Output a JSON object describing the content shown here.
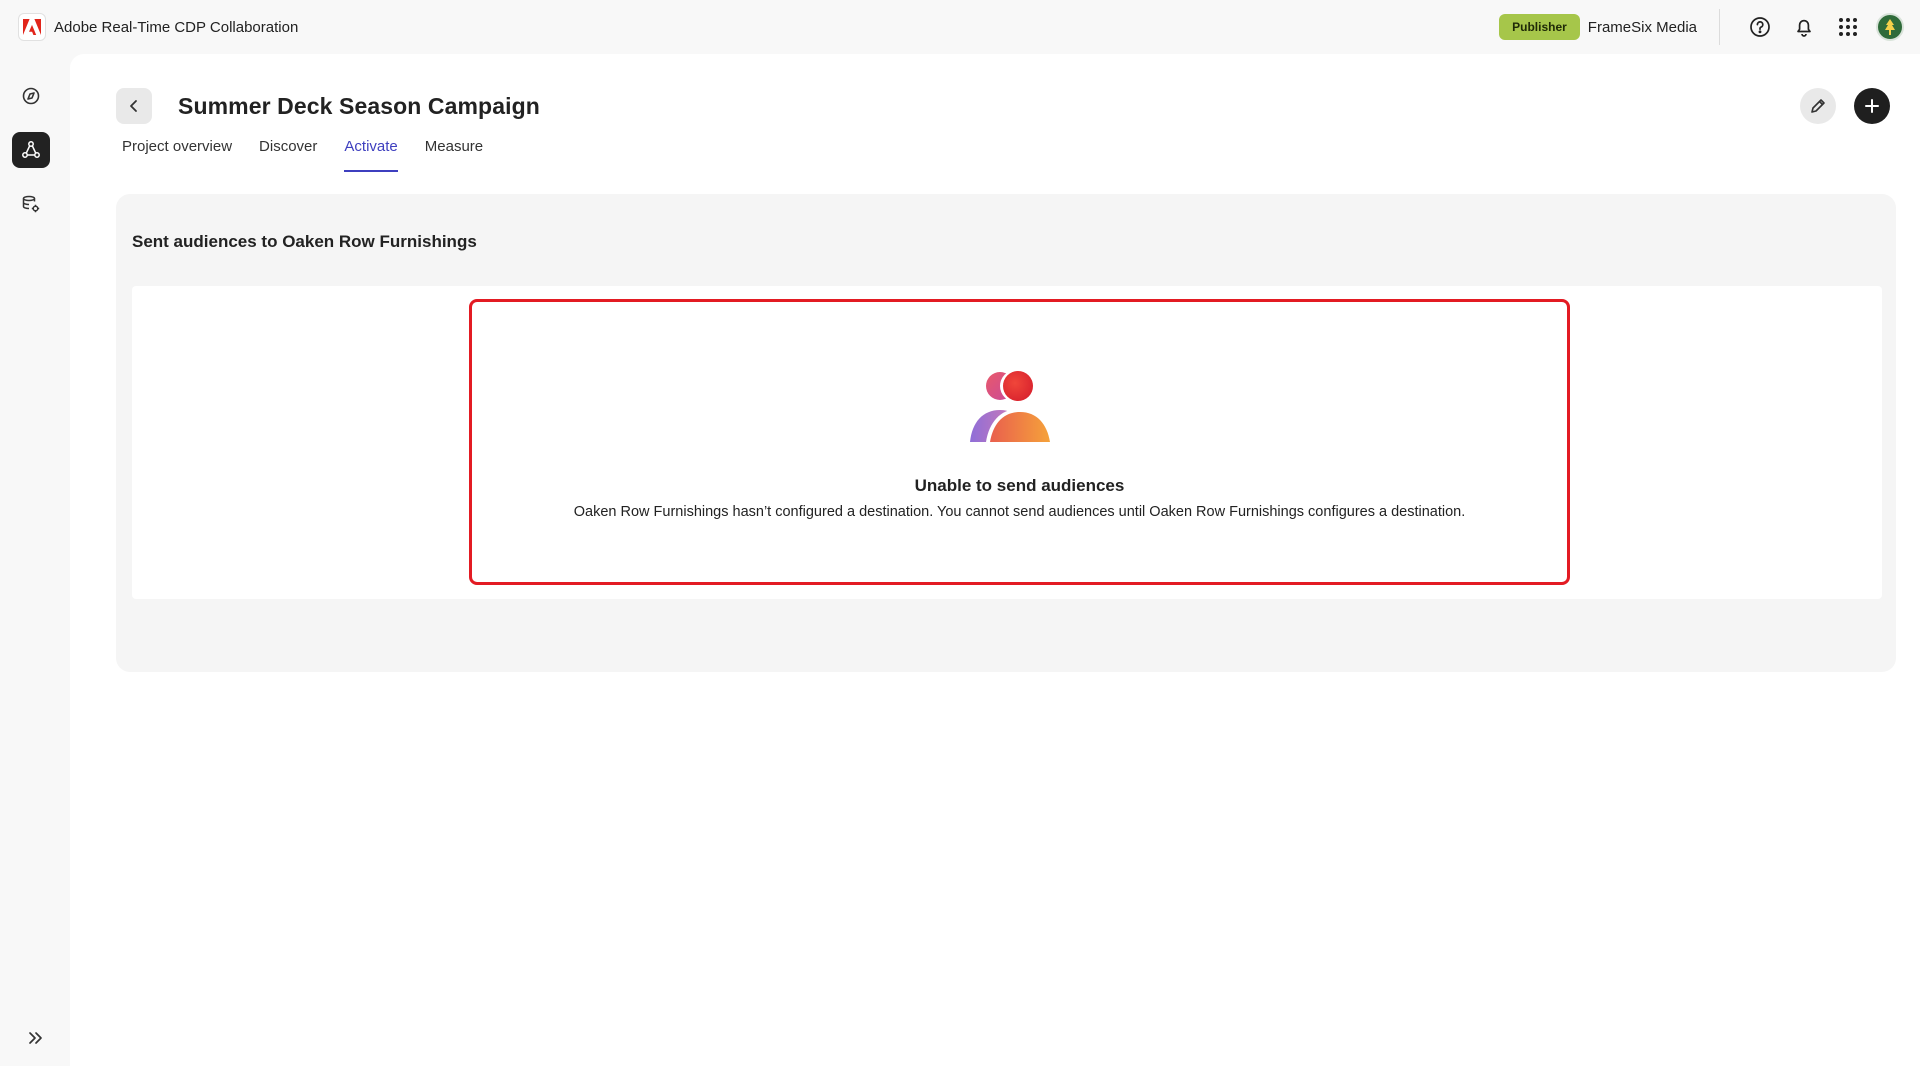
{
  "app": {
    "title": "Adobe Real-Time CDP Collaboration",
    "role_badge": "Publisher",
    "org_name": "FrameSix Media"
  },
  "icons": {
    "brand": "adobe-logo-icon",
    "help": "help-icon",
    "notifications": "bell-icon",
    "apps": "app-grid-icon",
    "avatar": "user-avatar",
    "rail": [
      "compass-icon",
      "collaboration-icon",
      "data-settings-icon"
    ],
    "expand": "expand-rail-icon"
  },
  "project": {
    "title": "Summer Deck Season Campaign",
    "tabs": [
      {
        "label": "Project overview",
        "active": false
      },
      {
        "label": "Discover",
        "active": false
      },
      {
        "label": "Activate",
        "active": true
      },
      {
        "label": "Measure",
        "active": false
      }
    ]
  },
  "activate": {
    "section_title": "Sent audiences to Oaken Row Furnishings",
    "empty_state": {
      "title": "Unable to send audiences",
      "description": "Oaken Row Furnishings hasn’t configured a destination. You cannot send audiences until Oaken Row Furnishings configures a destination."
    }
  },
  "colors": {
    "accent": "#3e3fbf",
    "badge": "#a6c64a",
    "highlight": "#e31b23"
  }
}
